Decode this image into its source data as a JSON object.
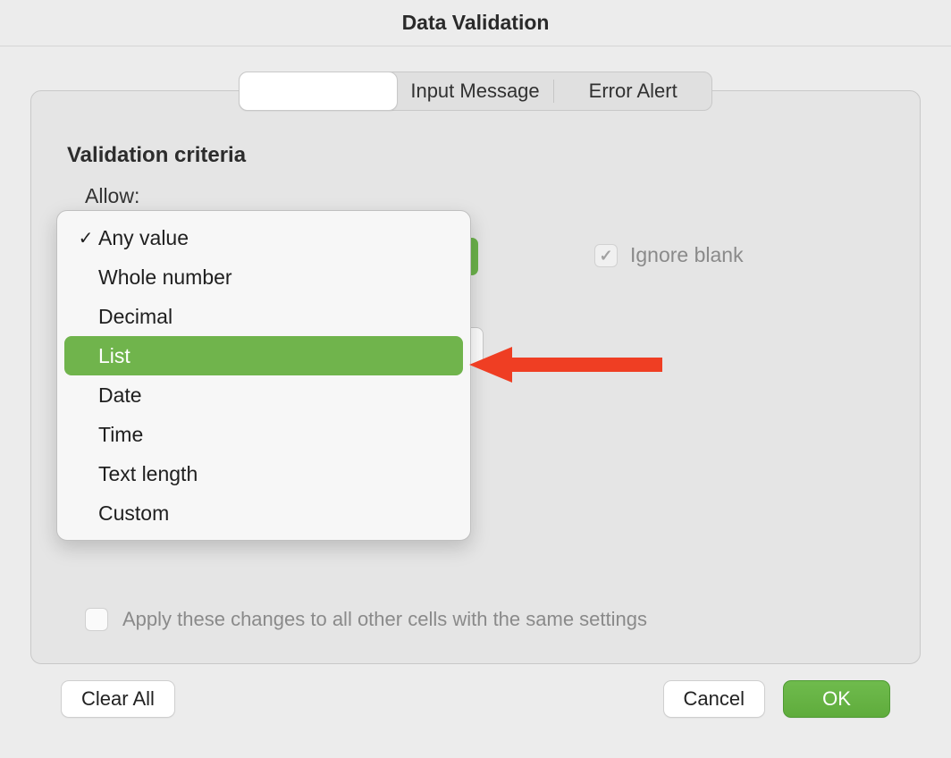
{
  "title": "Data Validation",
  "tabs": [
    {
      "label": ""
    },
    {
      "label": "Input Message"
    },
    {
      "label": "Error Alert"
    }
  ],
  "selected_tab_index": 0,
  "section_heading": "Validation criteria",
  "allow_label": "Allow:",
  "dropdown": {
    "options": [
      {
        "label": "Any value",
        "checked": true,
        "highlighted": false
      },
      {
        "label": "Whole number",
        "checked": false,
        "highlighted": false
      },
      {
        "label": "Decimal",
        "checked": false,
        "highlighted": false
      },
      {
        "label": "List",
        "checked": false,
        "highlighted": true
      },
      {
        "label": "Date",
        "checked": false,
        "highlighted": false
      },
      {
        "label": "Time",
        "checked": false,
        "highlighted": false
      },
      {
        "label": "Text length",
        "checked": false,
        "highlighted": false
      },
      {
        "label": "Custom",
        "checked": false,
        "highlighted": false
      }
    ]
  },
  "ignore_blank": {
    "label": "Ignore blank",
    "checked": true,
    "enabled": false
  },
  "apply_changes": {
    "label": "Apply these changes to all other cells with the same settings",
    "checked": false,
    "enabled": false
  },
  "buttons": {
    "clear_all": "Clear All",
    "cancel": "Cancel",
    "ok": "OK"
  },
  "stub_glyph": "›",
  "colors": {
    "accent_green": "#6bb24b",
    "arrow_red": "#ef3e23"
  }
}
